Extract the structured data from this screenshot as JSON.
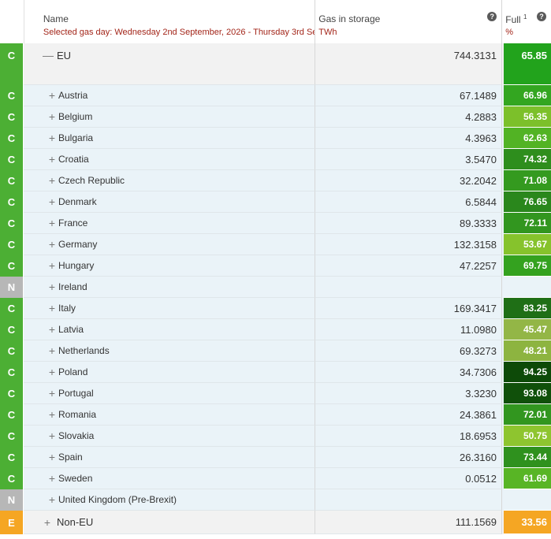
{
  "header": {
    "name_title": "Name",
    "gas_day": "Selected gas day: Wednesday 2nd September, 2026 - Thursday 3rd Se",
    "storage_title": "Gas in storage",
    "storage_unit": "TWh",
    "full_title": "Full",
    "full_sup": "1",
    "full_unit": "%",
    "help_glyph": "?"
  },
  "eu": {
    "status": "C",
    "toggle": "—",
    "name": "EU",
    "value": "744.3131",
    "full": "65.85",
    "color": "#22a31c"
  },
  "countries": [
    {
      "status": "C",
      "toggle": "+",
      "name": "Austria",
      "value": "67.1489",
      "full": "66.96",
      "color": "#33a620"
    },
    {
      "status": "C",
      "toggle": "+",
      "name": "Belgium",
      "value": "4.2883",
      "full": "56.35",
      "color": "#7cc02a"
    },
    {
      "status": "C",
      "toggle": "+",
      "name": "Bulgaria",
      "value": "4.3963",
      "full": "62.63",
      "color": "#52b324"
    },
    {
      "status": "C",
      "toggle": "+",
      "name": "Croatia",
      "value": "3.5470",
      "full": "74.32",
      "color": "#2e8e1d"
    },
    {
      "status": "C",
      "toggle": "+",
      "name": "Czech Republic",
      "value": "32.2042",
      "full": "71.08",
      "color": "#349a1f"
    },
    {
      "status": "C",
      "toggle": "+",
      "name": "Denmark",
      "value": "6.5844",
      "full": "76.65",
      "color": "#2a871c"
    },
    {
      "status": "C",
      "toggle": "+",
      "name": "France",
      "value": "89.3333",
      "full": "72.11",
      "color": "#32961f"
    },
    {
      "status": "C",
      "toggle": "+",
      "name": "Germany",
      "value": "132.3158",
      "full": "53.67",
      "color": "#86c32c"
    },
    {
      "status": "C",
      "toggle": "+",
      "name": "Hungary",
      "value": "47.2257",
      "full": "69.75",
      "color": "#34a21f"
    },
    {
      "status": "N",
      "toggle": "+",
      "name": "Ireland",
      "value": "",
      "full": "",
      "color": "#eaf3f8"
    },
    {
      "status": "C",
      "toggle": "+",
      "name": "Italy",
      "value": "169.3417",
      "full": "83.25",
      "color": "#1f6f16"
    },
    {
      "status": "C",
      "toggle": "+",
      "name": "Latvia",
      "value": "11.0980",
      "full": "45.47",
      "color": "#93b646"
    },
    {
      "status": "C",
      "toggle": "+",
      "name": "Netherlands",
      "value": "69.3273",
      "full": "48.21",
      "color": "#8db440"
    },
    {
      "status": "C",
      "toggle": "+",
      "name": "Poland",
      "value": "34.7306",
      "full": "94.25",
      "color": "#0d4a08"
    },
    {
      "status": "C",
      "toggle": "+",
      "name": "Portugal",
      "value": "3.3230",
      "full": "93.08",
      "color": "#10500a"
    },
    {
      "status": "C",
      "toggle": "+",
      "name": "Romania",
      "value": "24.3861",
      "full": "72.01",
      "color": "#32961f"
    },
    {
      "status": "C",
      "toggle": "+",
      "name": "Slovakia",
      "value": "18.6953",
      "full": "50.75",
      "color": "#8ec52f"
    },
    {
      "status": "C",
      "toggle": "+",
      "name": "Spain",
      "value": "26.3160",
      "full": "73.44",
      "color": "#2f911e"
    },
    {
      "status": "C",
      "toggle": "+",
      "name": "Sweden",
      "value": "0.0512",
      "full": "61.69",
      "color": "#58b525"
    },
    {
      "status": "N",
      "toggle": "+",
      "name": "United Kingdom (Pre-Brexit)",
      "value": "",
      "full": "",
      "color": "#eaf3f8"
    }
  ],
  "noneu": {
    "status": "E",
    "toggle": "+",
    "name": "Non-EU",
    "value": "111.1569",
    "full": "33.56",
    "color": "#f5a623"
  }
}
